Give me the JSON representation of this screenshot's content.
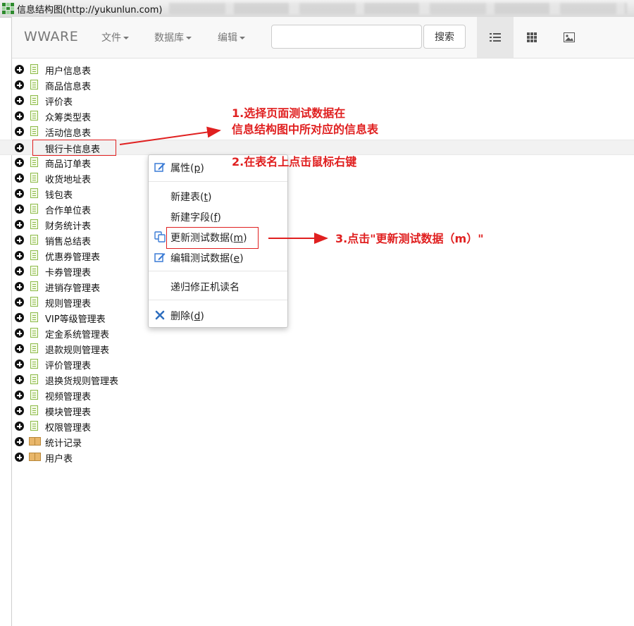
{
  "window": {
    "title": "信息结构图(http://yukunlun.com)"
  },
  "navbar": {
    "brand": "WWARE",
    "menus": [
      "文件",
      "数据库",
      "编辑"
    ],
    "search_placeholder": "",
    "search_button": "搜索",
    "views": [
      "list-view-icon",
      "grid-view-icon",
      "image-view-icon"
    ]
  },
  "tree": {
    "items": [
      {
        "label": "用户信息表",
        "icon": "doc-icon"
      },
      {
        "label": "商品信息表",
        "icon": "doc-icon"
      },
      {
        "label": "评价表",
        "icon": "doc-icon"
      },
      {
        "label": "众筹类型表",
        "icon": "doc-icon"
      },
      {
        "label": "活动信息表",
        "icon": "doc-icon"
      },
      {
        "label": "银行卡信息表",
        "icon": "none",
        "selected": true
      },
      {
        "label": "商品订单表",
        "icon": "doc-icon"
      },
      {
        "label": "收货地址表",
        "icon": "doc-icon"
      },
      {
        "label": "钱包表",
        "icon": "doc-icon"
      },
      {
        "label": "合作单位表",
        "icon": "doc-icon"
      },
      {
        "label": "财务统计表",
        "icon": "doc-icon"
      },
      {
        "label": "销售总结表",
        "icon": "doc-icon"
      },
      {
        "label": "优惠券管理表",
        "icon": "doc-icon"
      },
      {
        "label": "卡券管理表",
        "icon": "doc-icon"
      },
      {
        "label": "进销存管理表",
        "icon": "doc-icon"
      },
      {
        "label": "规则管理表",
        "icon": "doc-icon"
      },
      {
        "label": "VIP等级管理表",
        "icon": "doc-icon"
      },
      {
        "label": "定金系统管理表",
        "icon": "doc-icon"
      },
      {
        "label": "退款规则管理表",
        "icon": "doc-icon"
      },
      {
        "label": "评价管理表",
        "icon": "doc-icon"
      },
      {
        "label": "退换货规则管理表",
        "icon": "doc-icon"
      },
      {
        "label": "视频管理表",
        "icon": "doc-icon"
      },
      {
        "label": "模块管理表",
        "icon": "doc-icon"
      },
      {
        "label": "权限管理表",
        "icon": "doc-icon"
      },
      {
        "label": "统计记录",
        "icon": "book-icon"
      },
      {
        "label": "用户表",
        "icon": "book-icon"
      }
    ]
  },
  "context_menu": {
    "properties": {
      "text": "属性",
      "key": "p"
    },
    "new_table": {
      "text": "新建表",
      "key": "t"
    },
    "new_field": {
      "text": "新建字段",
      "key": "f"
    },
    "update_test_data": {
      "text": "更新测试数据",
      "key": "m"
    },
    "edit_test_data": {
      "text": "编辑测试数据",
      "key": "e"
    },
    "recursive_fix": {
      "text": "递归修正机读名"
    },
    "delete": {
      "text": "删除",
      "key": "d"
    }
  },
  "annotations": {
    "step1_line1": "1.选择页面测试数据在",
    "step1_line2": "信息结构图中所对应的信息表",
    "step2": "2.在表名上点击鼠标右键",
    "step3": "3.点击\"更新测试数据（m）\""
  },
  "colors": {
    "annotation": "#e02020",
    "icon_blue": "#3a7bd5",
    "delete_blue": "#2f6fbf"
  }
}
